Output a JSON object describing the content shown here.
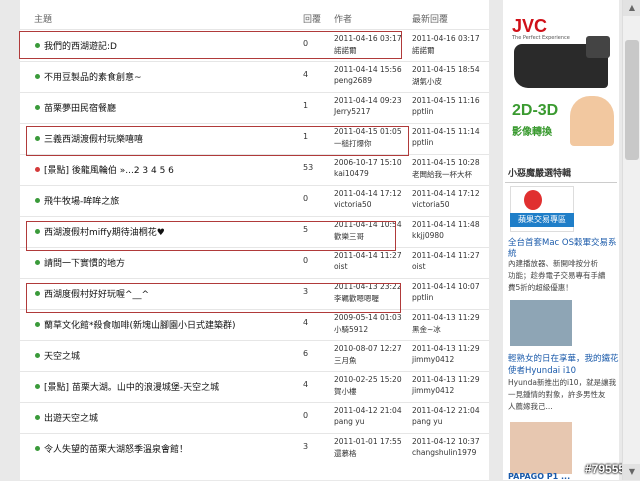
{
  "header": {
    "subject": "主題",
    "replies": "回覆",
    "author": "作者",
    "last_reply": "最新回覆"
  },
  "rows": [
    {
      "title": "我們的西湖遊記:D",
      "replies": "0",
      "author_date": "2011-04-16 03:17",
      "author": "諾諾爾",
      "last_date": "2011-04-16 03:17",
      "last_user": "諾諾爾",
      "dot": "green"
    },
    {
      "title": "不用豆製品的素食創意~",
      "replies": "4",
      "author_date": "2011-04-14 15:56",
      "author": "peng2689",
      "last_date": "2011-04-15 18:54",
      "last_user": "湖氣小皮",
      "dot": "green"
    },
    {
      "title": "苗栗夢田民宿餐廳",
      "replies": "1",
      "author_date": "2011-04-14 09:23",
      "author": "Jerry5217",
      "last_date": "2011-04-15 11:16",
      "last_user": "pptlin",
      "dot": "green"
    },
    {
      "title": "三義西湖渡假村玩樂嘻嘻",
      "replies": "1",
      "author_date": "2011-04-15 01:05",
      "author": "一槌打爆你",
      "last_date": "2011-04-15 11:14",
      "last_user": "pptlin",
      "dot": "green"
    },
    {
      "title": "[景點] 後龍風輪伯 »...2 3 4 5 6",
      "replies": "53",
      "author_date": "2006-10-17 15:10",
      "author": "kai10479",
      "last_date": "2011-04-15 10:28",
      "last_user": "老闆給我一杯大杯",
      "dot": "red"
    },
    {
      "title": "飛牛牧場-哞哞之旅",
      "replies": "0",
      "author_date": "2011-04-14 17:12",
      "author": "victoria50",
      "last_date": "2011-04-14 17:12",
      "last_user": "victoria50",
      "dot": "green"
    },
    {
      "title": "西湖渡假村miffy期待油桐花♥",
      "replies": "5",
      "author_date": "2011-04-14 10:54",
      "author": "歡樂三哥",
      "last_date": "2011-04-14 11:48",
      "last_user": "kkjj0980",
      "dot": "green"
    },
    {
      "title": "請問一下實慣的地方",
      "replies": "0",
      "author_date": "2011-04-14 11:27",
      "author": "oist",
      "last_date": "2011-04-14 11:27",
      "last_user": "oist",
      "dot": "green"
    },
    {
      "title": "西湖度假村好好玩喔^__^",
      "replies": "3",
      "author_date": "2011-04-13 23:22",
      "author": "李羈歡嗯嗯喔",
      "last_date": "2011-04-14 10:07",
      "last_user": "pptlin",
      "dot": "green"
    },
    {
      "title": "蘭草文化館*殺食咖啡(新塊山腳園小日式建築群)",
      "replies": "4",
      "author_date": "2009-05-14 01:03",
      "author": "小騎5912",
      "last_date": "2011-04-13 11:29",
      "last_user": "黑金~冰",
      "dot": "green"
    },
    {
      "title": "天空之城",
      "replies": "6",
      "author_date": "2010-08-07 12:27",
      "author": "三月魚",
      "last_date": "2011-04-13 11:29",
      "last_user": "jimmy0412",
      "dot": "green"
    },
    {
      "title": "[景點] 苗栗大湖。山中的浪漫城堡-天空之城",
      "replies": "4",
      "author_date": "2010-02-25 15:20",
      "author": "賀小樓",
      "last_date": "2011-04-13 11:29",
      "last_user": "jimmy0412",
      "dot": "green"
    },
    {
      "title": "出遊天空之城",
      "replies": "0",
      "author_date": "2011-04-12 21:04",
      "author": "pang yu",
      "last_date": "2011-04-12 21:04",
      "last_user": "pang yu",
      "dot": "green"
    },
    {
      "title": "令人失望的苗栗大湖怒季溫泉會館！",
      "replies": "3",
      "author_date": "2011-01-01 17:55",
      "author": "還慕格",
      "last_date": "2011-04-12 10:37",
      "last_user": "changshulin1979",
      "dot": "green"
    }
  ],
  "sidebar": {
    "jvc_logo": "JVC",
    "jvc_tagline": "The Perfect Experience",
    "jvc_3d": "2D-3D",
    "jvc_3d_sub": "影像轉換",
    "section_title": "小惡魔嚴選特輯",
    "badge_label": "蘋果交易專區",
    "link1": "全台首套Mac OS穀軍交易系",
    "link1b": "統",
    "desc1a": "內建播放器、新開啡按分析",
    "desc1b": "功能；趁券電子交易專有手續",
    "desc1c": "費5折的超級優惠！",
    "link2": "輕熟女的日在享華，我的鐵花",
    "link2b": "使者Hyundai i10",
    "desc2a": "Hyunda新推出的i10，就是讓我",
    "desc2b": "一見鍾情的對象，許多男性友",
    "desc2c": "人薦嫁我己...",
    "bottom_label": "PAPAGO P1 ...",
    "watermark": "#795559"
  }
}
